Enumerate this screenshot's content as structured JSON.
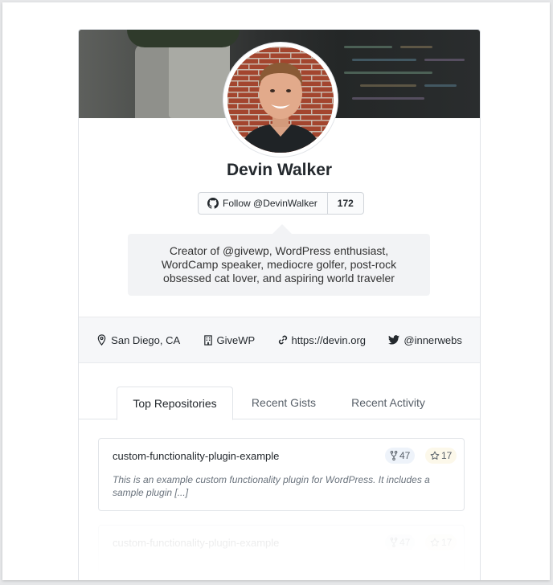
{
  "profile": {
    "name": "Devin Walker",
    "follow_label": "Follow @DevinWalker",
    "followers": "172",
    "bio_lines": [
      "Creator of @givewp, WordPress enthusiast,",
      "WordCamp speaker, mediocre golfer, post-rock",
      "obsessed cat lover, and aspiring world traveler"
    ]
  },
  "meta": {
    "location": "San Diego, CA",
    "company": "GiveWP",
    "website": "https://devin.org",
    "twitter": "@innerwebs"
  },
  "tabs": [
    {
      "label": "Top Repositories",
      "active": true
    },
    {
      "label": "Recent Gists",
      "active": false
    },
    {
      "label": "Recent Activity",
      "active": false
    }
  ],
  "repos": [
    {
      "name": "custom-functionality-plugin-example",
      "forks": "47",
      "stars": "17",
      "description": "This is an example custom functionality plugin for WordPress. It includes a sample plugin [...]"
    },
    {
      "name": "custom-functionality-plugin-example",
      "forks": "47",
      "stars": "17"
    }
  ],
  "icons": {
    "github": "github-icon",
    "location": "map-pin-icon",
    "company": "building-icon",
    "website": "link-icon",
    "twitter": "twitter-icon",
    "forks": "fork-icon",
    "stars": "star-icon"
  }
}
